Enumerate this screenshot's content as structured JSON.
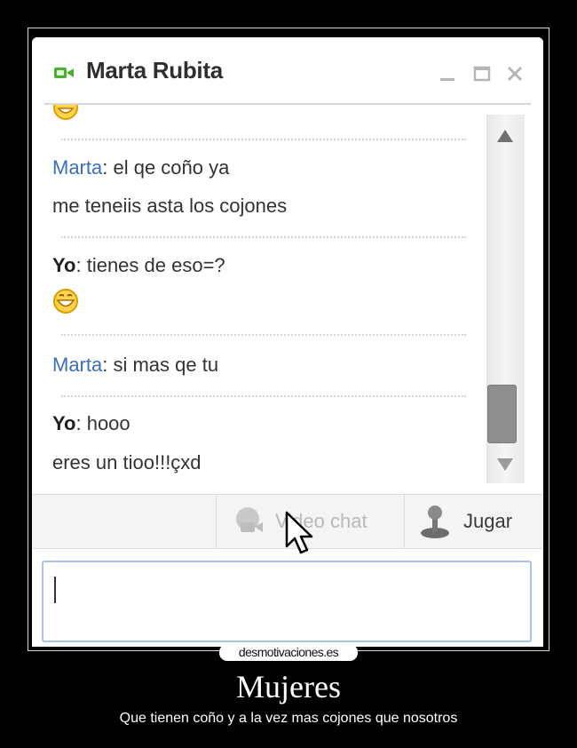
{
  "window": {
    "title": "Marta Rubita",
    "contact_icon": "video-camera-icon",
    "controls": [
      "minimize-icon",
      "maximize-icon",
      "close-icon"
    ]
  },
  "messages": [
    {
      "sender": "Marta",
      "sender_type": "other",
      "text": ": el qe coño ya"
    },
    {
      "sender": "",
      "sender_type": "other",
      "text": "me teneiis asta los cojones"
    },
    {
      "sender": "Yo",
      "sender_type": "me",
      "text": ": tienes de eso=?"
    },
    {
      "sender": "Marta",
      "sender_type": "other",
      "text": ": si mas qe tu"
    },
    {
      "sender": "Yo",
      "sender_type": "me",
      "text": ": hooo"
    },
    {
      "sender": "",
      "sender_type": "me",
      "text": "eres un tioo!!!çxd"
    }
  ],
  "emoticons": [
    "smiley-icon",
    "laughing-smiley-icon"
  ],
  "toolbar": {
    "video_chat_label": "Video chat",
    "video_chat_state": "disabled",
    "play_label": "Jugar"
  },
  "input": {
    "value": ""
  },
  "watermark": "desmotivaciones.es",
  "caption": {
    "title": "Mujeres",
    "subtitle": "Que tienen coño y a la vez mas cojones que nosotros"
  },
  "colors": {
    "other_name": "#3b6fb6",
    "me_name": "#222222",
    "accent_green": "#4caf2f",
    "input_border": "#a9c3e6",
    "background": "#000000"
  }
}
